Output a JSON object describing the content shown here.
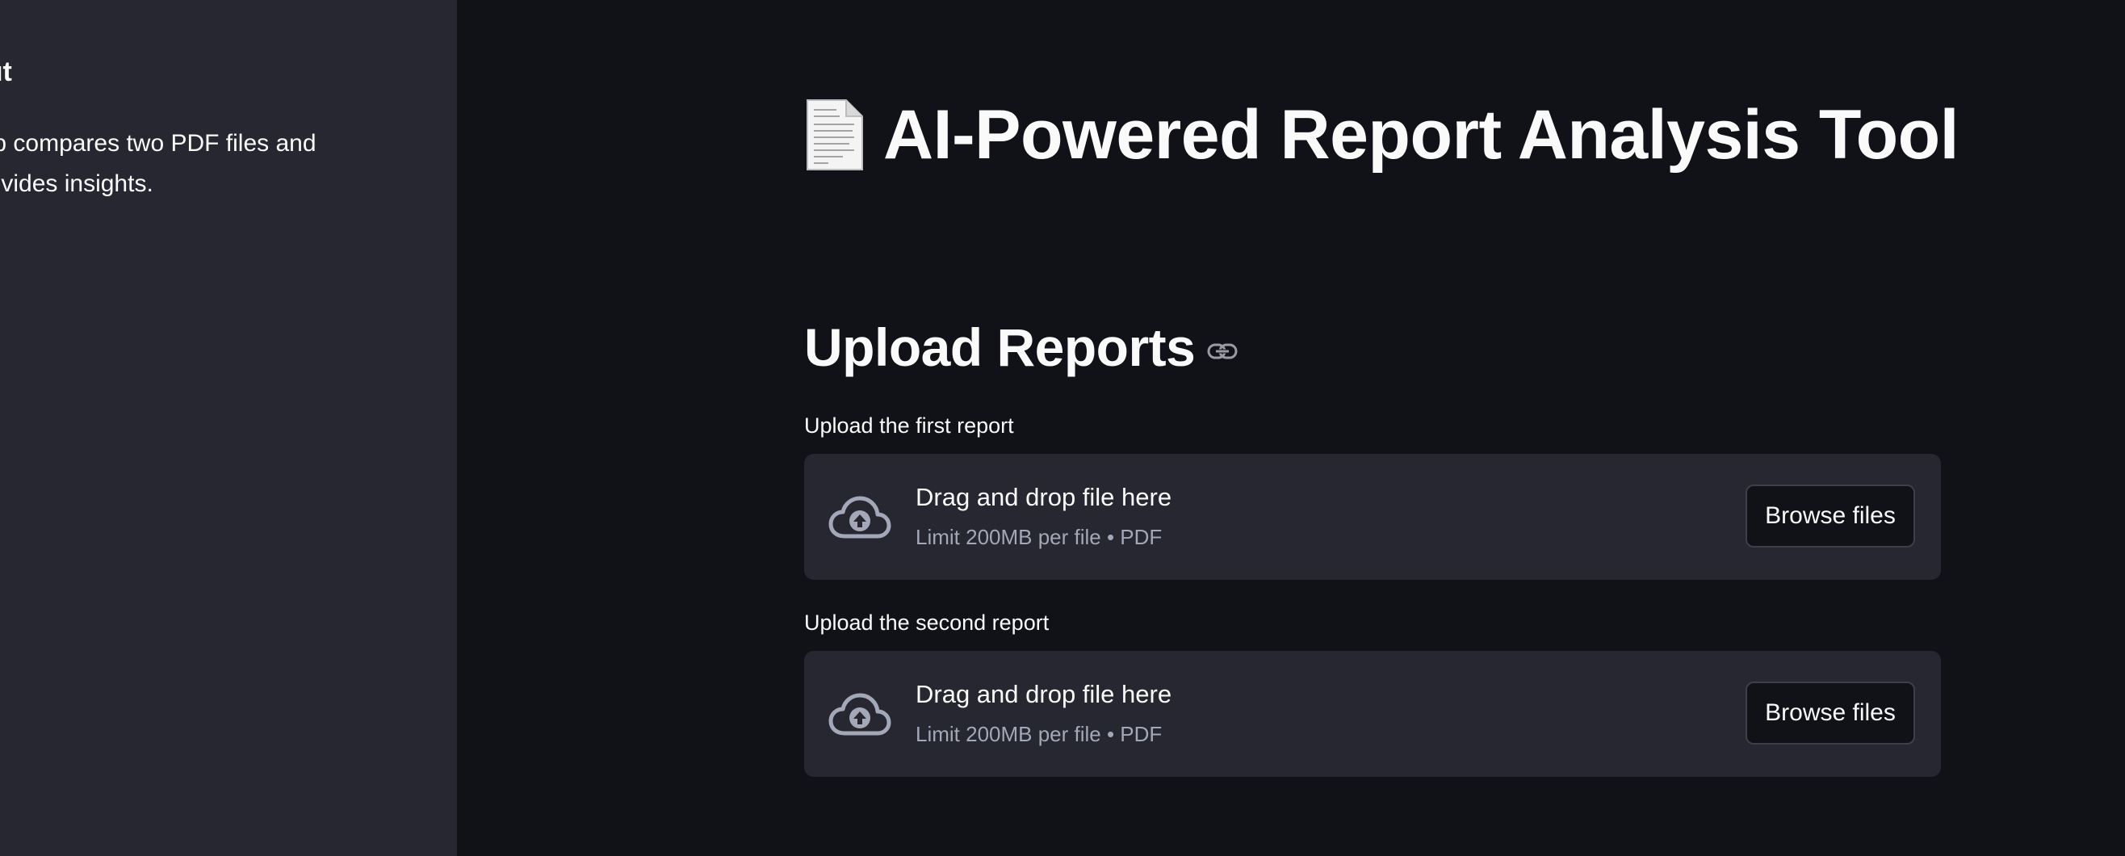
{
  "sidebar": {
    "heading": "out",
    "text": "app compares two PDF files and provides insights."
  },
  "main": {
    "title": "AI-Powered Report Analysis Tool",
    "title_icon": "page-facing-up-icon",
    "section_heading": "Upload Reports",
    "uploaders": [
      {
        "label": "Upload the first report",
        "drop_text": "Drag and drop file here",
        "limit_text": "Limit 200MB per file • PDF",
        "button_label": "Browse files"
      },
      {
        "label": "Upload the second report",
        "drop_text": "Drag and drop file here",
        "limit_text": "Limit 200MB per file • PDF",
        "button_label": "Browse files"
      }
    ]
  },
  "colors": {
    "background": "#111217",
    "sidebar": "#262730",
    "dropzone": "#262730",
    "text": "#fafafa",
    "muted_text": "#a3a8b8"
  }
}
